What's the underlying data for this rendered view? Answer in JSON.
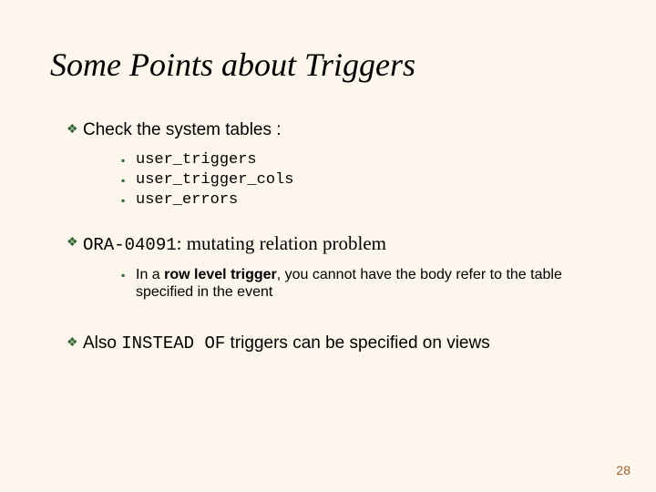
{
  "title": "Some Points about Triggers",
  "points": {
    "p1": {
      "text": "Check the system tables :"
    },
    "p1_sub": {
      "a": "user_triggers",
      "b": "user_trigger_cols",
      "c": "user_errors"
    },
    "p2": {
      "code": "ORA-04091",
      "rest": ": mutating relation problem"
    },
    "p2_sub": {
      "pre": "In a ",
      "bold": "row level trigger",
      "post": ", you cannot have the body refer to the table specified in the event"
    },
    "p3": {
      "a": "Also ",
      "code": "INSTEAD OF",
      "b": " triggers can be specified on views"
    }
  },
  "page_number": "28"
}
